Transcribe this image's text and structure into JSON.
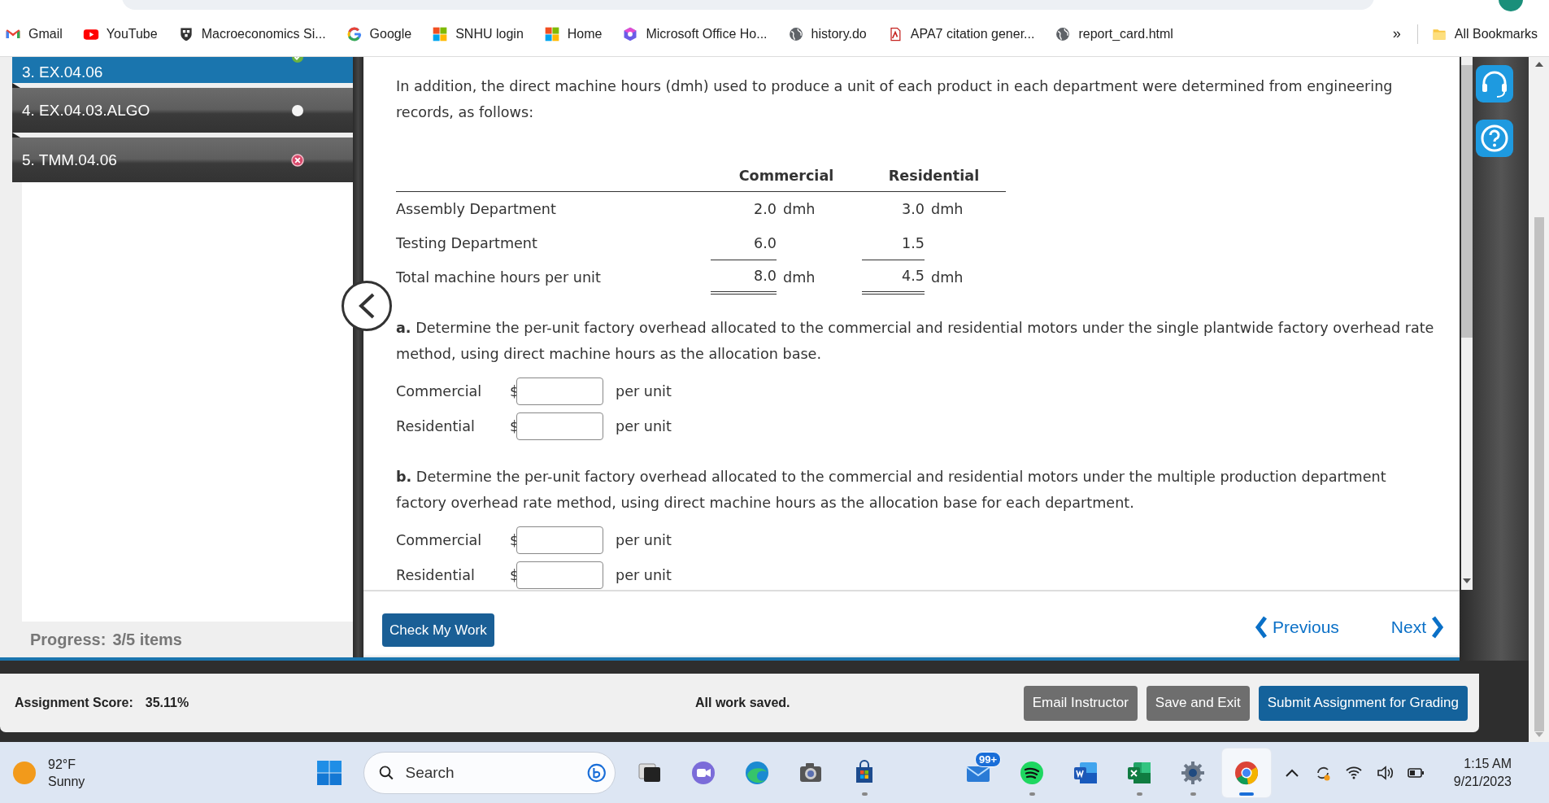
{
  "bookmarks": [
    {
      "label": "Gmail",
      "kind": "mail"
    },
    {
      "label": "YouTube",
      "kind": "video"
    },
    {
      "label": "Macroeconomics Si...",
      "kind": "shield"
    },
    {
      "label": "Google",
      "kind": "g"
    },
    {
      "label": "SNHU login",
      "kind": "tiles"
    },
    {
      "label": "Home",
      "kind": "tiles"
    },
    {
      "label": "Microsoft Office Ho...",
      "kind": "hexagon"
    },
    {
      "label": "history.do",
      "kind": "globe"
    },
    {
      "label": "APA7 citation gener...",
      "kind": "pdf"
    },
    {
      "label": "report_card.html",
      "kind": "globe"
    }
  ],
  "bookmarks_overflow": "»",
  "all_bookmarks": "All Bookmarks",
  "sidebar": {
    "items": [
      {
        "label": "3. EX.04.06",
        "selected": true,
        "kind": "correct"
      },
      {
        "label": "4. EX.04.03.ALGO",
        "selected": false,
        "kind": "unanswered"
      },
      {
        "label": "5. TMM.04.06",
        "selected": false,
        "kind": "incorrect"
      }
    ],
    "progress_label": "Progress:",
    "progress_value": "3/5 items"
  },
  "content": {
    "intro": "In addition, the direct machine hours (dmh) used to produce a unit of each product in each department were determined from engineering records, as follows:",
    "table": {
      "columns": [
        "Commercial",
        "Residential"
      ],
      "rows": [
        {
          "label": "Assembly Department",
          "kind": "plain",
          "cells": [
            {
              "value": "2.0",
              "unit": "dmh"
            },
            {
              "value": "3.0",
              "unit": "dmh"
            }
          ]
        },
        {
          "label": "Testing Department",
          "kind": "ruled",
          "cells": [
            {
              "value": "6.0"
            },
            {
              "value": "1.5"
            }
          ]
        },
        {
          "label": "Total machine hours per unit",
          "kind": "total",
          "cells": [
            {
              "value": "8.0",
              "unit": "dmh"
            },
            {
              "value": "4.5",
              "unit": "dmh"
            }
          ]
        }
      ]
    },
    "questions": [
      {
        "text": "**a.** Determine the per-unit factory overhead allocated to the commercial and residential motors under the single plantwide factory overhead rate method, using direct machine hours as the allocation base.",
        "answers": [
          {
            "label": "Commercial",
            "currency": "$",
            "suffix": "per unit"
          },
          {
            "label": "Residential",
            "currency": "$",
            "suffix": "per unit"
          }
        ]
      },
      {
        "text": "**b.** Determine the per-unit factory overhead allocated to the commercial and residential motors under the multiple production department factory overhead rate method, using direct machine hours as the allocation base for each department.",
        "answers": [
          {
            "label": "Commercial",
            "currency": "$",
            "suffix": "per unit"
          },
          {
            "label": "Residential",
            "currency": "$",
            "suffix": "per unit"
          }
        ]
      }
    ]
  },
  "footer": {
    "check": "Check My Work",
    "previous": "Previous",
    "next": "Next"
  },
  "score_bar": {
    "score_label": "Assignment Score:",
    "score_value": "35.11%",
    "status": "All work saved.",
    "buttons": [
      {
        "label": "Email Instructor",
        "kind": "secondary"
      },
      {
        "label": "Save and Exit",
        "kind": "secondary"
      },
      {
        "label": "Submit Assignment for Grading",
        "kind": "primary"
      }
    ]
  },
  "taskbar": {
    "temperature": "92°F",
    "weather": "Sunny",
    "search_placeholder": "Search",
    "apps": [
      {
        "kind": "taskview",
        "running": false,
        "selected": false
      },
      {
        "kind": "meet",
        "running": false,
        "selected": false
      },
      {
        "kind": "edge",
        "running": false,
        "selected": false
      },
      {
        "kind": "camera",
        "running": false,
        "selected": false
      },
      {
        "kind": "store",
        "running": true,
        "selected": false
      },
      {
        "kind": "mail",
        "running": false,
        "selected": false,
        "badge": "99+"
      },
      {
        "kind": "spotify",
        "running": true,
        "selected": false
      },
      {
        "kind": "word",
        "running": false,
        "selected": false
      },
      {
        "kind": "excel",
        "running": true,
        "selected": false
      },
      {
        "kind": "settings",
        "running": true,
        "selected": false
      },
      {
        "kind": "chrome",
        "running": true,
        "selected": true
      }
    ],
    "time": "1:15 AM",
    "date": "9/21/2023"
  }
}
